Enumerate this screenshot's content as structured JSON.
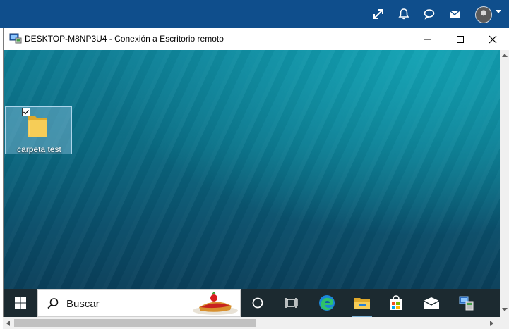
{
  "outer_topbar": {
    "bg_color": "#0f4e8c",
    "icons": [
      "expand-icon",
      "bell-icon",
      "chat-icon",
      "mail-icon"
    ],
    "avatar": "user-avatar"
  },
  "rdp_window": {
    "title": "DESKTOP-M8NP3U4 - Conexión a Escritorio remoto",
    "controls": [
      "minimize",
      "maximize",
      "close"
    ]
  },
  "desktop": {
    "icons": [
      {
        "label": "carpeta test",
        "icon": "folder-icon",
        "selected": true
      }
    ]
  },
  "taskbar": {
    "search_placeholder": "Buscar",
    "apps": [
      "cortana-icon",
      "task-view-icon",
      "edge-icon",
      "file-explorer-icon",
      "store-icon",
      "mail-icon",
      "rdp-app-icon"
    ],
    "bg_color": "#1c2a30"
  }
}
